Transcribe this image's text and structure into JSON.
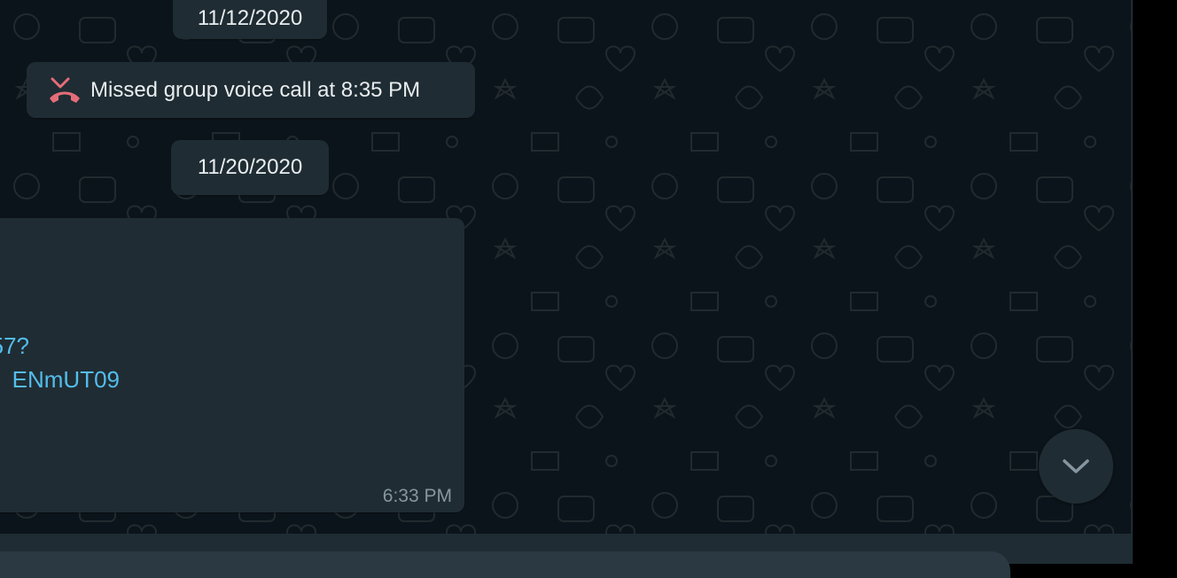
{
  "chat": {
    "date_chip_1": "11/12/2020",
    "missed_call": {
      "icon": "missed-call-icon",
      "text": "Missed group voice call at 8:35 PM"
    },
    "date_chip_2": "11/20/2020",
    "message": {
      "link_line_1": "57?",
      "link_line_2": "ENmUT09",
      "time": "6:33 PM"
    },
    "scroll_down_button": {
      "icon": "chevron-down-icon"
    }
  },
  "colors": {
    "background": "#0b141a",
    "bubble": "#202c33",
    "link": "#53bdeb",
    "missed_call_icon": "#e46d79",
    "text": "#e9edef",
    "meta_text": "#8696a0"
  }
}
